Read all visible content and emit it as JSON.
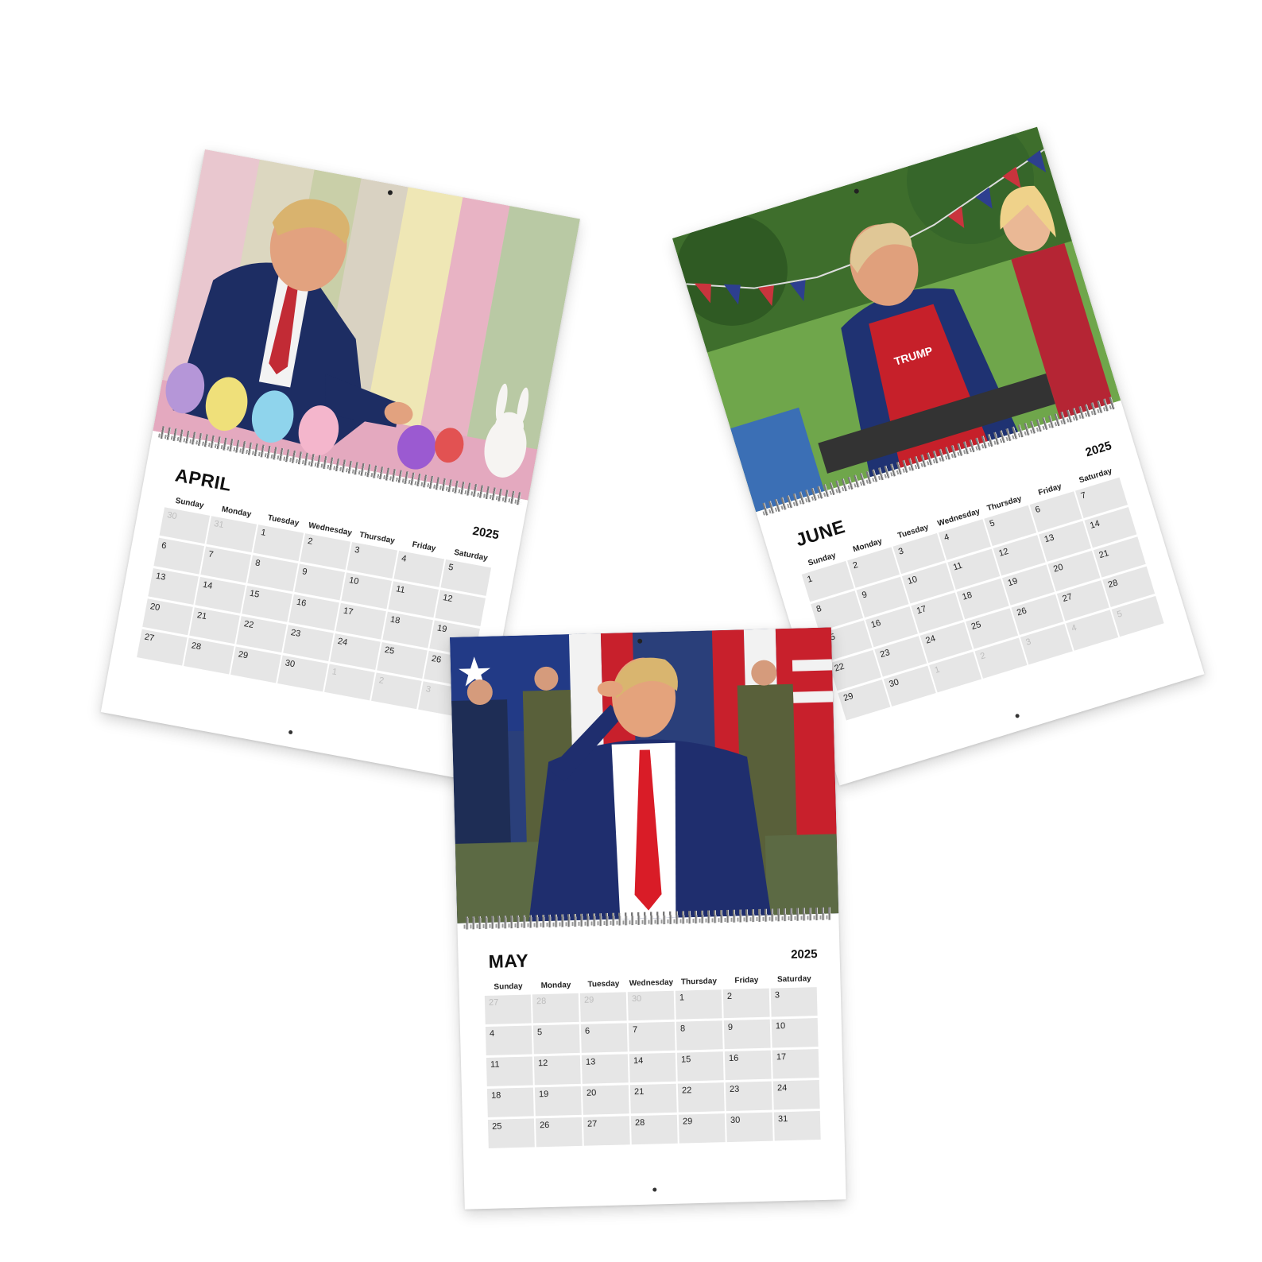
{
  "days_of_week": [
    "Sunday",
    "Monday",
    "Tuesday",
    "Wednesday",
    "Thursday",
    "Friday",
    "Saturday"
  ],
  "calendars": {
    "april": {
      "month": "APRIL",
      "year": "2025",
      "photo": "man-painting-easter-eggs",
      "days": [
        "30",
        "31",
        "1",
        "2",
        "3",
        "4",
        "5",
        "6",
        "7",
        "8",
        "9",
        "10",
        "11",
        "12",
        "13",
        "14",
        "15",
        "16",
        "17",
        "18",
        "19",
        "20",
        "21",
        "22",
        "23",
        "24",
        "25",
        "26",
        "27",
        "28",
        "29",
        "30",
        "1",
        "2",
        "3"
      ],
      "in_month_start": 2,
      "in_month_end": 31
    },
    "may": {
      "month": "MAY",
      "year": "2025",
      "photo": "man-saluting-with-soldiers",
      "days": [
        "27",
        "28",
        "29",
        "30",
        "1",
        "2",
        "3",
        "4",
        "5",
        "6",
        "7",
        "8",
        "9",
        "10",
        "11",
        "12",
        "13",
        "14",
        "15",
        "16",
        "17",
        "18",
        "19",
        "20",
        "21",
        "22",
        "23",
        "24",
        "25",
        "26",
        "27",
        "28",
        "29",
        "30",
        "31"
      ],
      "in_month_start": 4,
      "in_month_end": 34
    },
    "june": {
      "month": "JUNE",
      "year": "2025",
      "photo": "man-grilling-at-picnic",
      "apron_text": "TRUMP",
      "days": [
        "1",
        "2",
        "3",
        "4",
        "5",
        "6",
        "7",
        "8",
        "9",
        "10",
        "11",
        "12",
        "13",
        "14",
        "15",
        "16",
        "17",
        "18",
        "19",
        "20",
        "21",
        "22",
        "23",
        "24",
        "25",
        "26",
        "27",
        "28",
        "29",
        "30",
        "1",
        "2",
        "3",
        "4",
        "5"
      ],
      "in_month_start": 0,
      "in_month_end": 29
    }
  }
}
